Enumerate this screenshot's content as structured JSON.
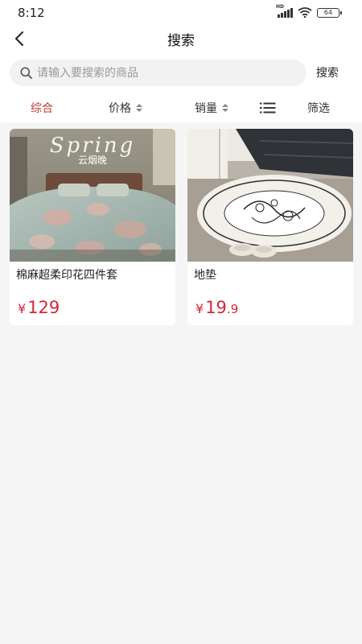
{
  "status_bar": {
    "time": "8:12",
    "battery": "64"
  },
  "nav": {
    "title": "搜索"
  },
  "search": {
    "placeholder": "请输入要搜索的商品",
    "value": "",
    "button_label": "搜索"
  },
  "filters": [
    {
      "label": "综合",
      "active": true
    },
    {
      "label": "价格",
      "sortable": true
    },
    {
      "label": "销量",
      "sortable": true
    },
    {
      "label": "筛选"
    }
  ],
  "products": [
    {
      "name": "棉麻超柔印花四件套",
      "price_symbol": "¥",
      "price_int": "129",
      "price_dec": "",
      "image_title": "Spring",
      "image_subtitle": "云烟晚",
      "image_icon": "bedding-set-photo"
    },
    {
      "name": "地垫",
      "price_symbol": "¥",
      "price_int": "19",
      "price_dec": ".9",
      "image_icon": "floor-mat-photo"
    }
  ],
  "colors": {
    "accent": "#c0392b",
    "price": "#d6243a"
  }
}
